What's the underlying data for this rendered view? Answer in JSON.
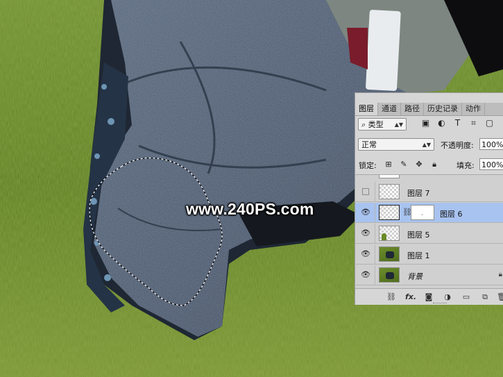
{
  "watermark": "www.240PS.com",
  "panel": {
    "tabs": [
      "图层",
      "通道",
      "路径",
      "历史记录",
      "动作"
    ],
    "active_tab": "图层",
    "filter": {
      "kind_label": "类型",
      "icons": [
        "image-filter-icon",
        "adjustment-filter-icon",
        "type-filter-icon",
        "shape-filter-icon",
        "smart-object-filter-icon"
      ]
    },
    "blend_mode": "正常",
    "opacity_label": "不透明度:",
    "opacity_value": "100%",
    "lock_label": "锁定:",
    "lock_icons": [
      "lock-transparent-icon",
      "lock-paint-icon",
      "lock-move-icon",
      "lock-all-icon"
    ],
    "fill_label": "填充:",
    "fill_value": "100%",
    "layers": [
      {
        "name": "图层 7",
        "visible": false,
        "thumb": "transparent",
        "selected": false,
        "mask": false,
        "locked": false
      },
      {
        "name": "图层 6",
        "visible": true,
        "thumb": "transparent",
        "selected": true,
        "mask": true,
        "locked": false
      },
      {
        "name": "图层 5",
        "visible": true,
        "thumb": "transparent-green",
        "selected": false,
        "mask": false,
        "locked": false
      },
      {
        "name": "图层 1",
        "visible": true,
        "thumb": "photo",
        "selected": false,
        "mask": false,
        "locked": false
      },
      {
        "name": "背景",
        "visible": true,
        "thumb": "photo",
        "selected": false,
        "mask": false,
        "locked": true
      }
    ],
    "bottom_icons": [
      "link-layers-icon",
      "fx-icon",
      "add-mask-icon",
      "adjustment-layer-icon",
      "new-group-icon",
      "new-layer-icon",
      "delete-layer-icon"
    ],
    "fx_label": "fx."
  },
  "colors": {
    "grass": "#6d8a2e",
    "fabric": "#4b5a6e",
    "selected_layer": "#a8c3ef",
    "panel_bg": "#d6d6d6"
  }
}
